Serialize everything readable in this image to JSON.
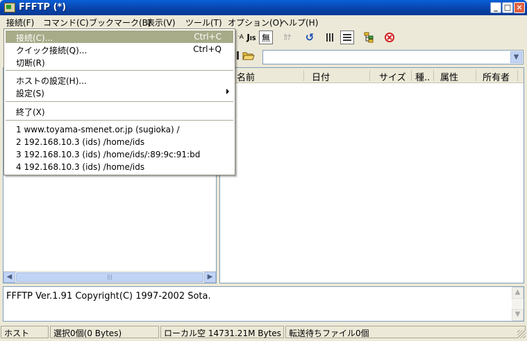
{
  "window": {
    "title": "FFFTP (*)"
  },
  "menubar": [
    "接続(F)",
    "コマンド(C)",
    "ブックマーク(B)",
    "表示(V)",
    "ツール(T)",
    "オプション(O)",
    "ヘルプ(H)"
  ],
  "toolbar": {
    "btn_j": "J",
    "btn_muji": "無",
    "btn_kana": "ｶﾅ"
  },
  "remote_list": {
    "columns": [
      "名前",
      "日付",
      "サイズ",
      "種..",
      "属性",
      "所有者"
    ]
  },
  "log": {
    "text": "FFFTP Ver.1.91 Copyright(C) 1997-2002 Sota."
  },
  "statusbar": {
    "host": "ホスト",
    "selection": "選択0個(0 Bytes)",
    "local_free": "ローカル空 14731.21M Bytes",
    "transfer_queue": "転送待ちファイル0個"
  },
  "connect_menu": {
    "items": [
      {
        "label": "接続(C)...",
        "shortcut": "Ctrl+C"
      },
      {
        "label": "クイック接続(Q)...",
        "shortcut": "Ctrl+Q"
      },
      {
        "label": "切断(R)",
        "shortcut": ""
      },
      {
        "label": "ホストの設定(H)...",
        "shortcut": ""
      },
      {
        "label": "設定(S)",
        "shortcut": ""
      },
      {
        "label": "終了(X)",
        "shortcut": ""
      },
      {
        "label": "1 www.toyama-smenet.or.jp (sugioka) /",
        "shortcut": ""
      },
      {
        "label": "2 192.168.10.3 (ids) /home/ids",
        "shortcut": ""
      },
      {
        "label": "3 192.168.10.3 (ids) /home/ids/:89:9c:91:bd",
        "shortcut": ""
      },
      {
        "label": "4 192.168.10.3 (ids) /home/ids",
        "shortcut": ""
      }
    ]
  },
  "colors": {
    "title_bar": "#0a5fd8",
    "menu_highlight": "#a8ab88",
    "window_bg": "#ece9d8"
  }
}
